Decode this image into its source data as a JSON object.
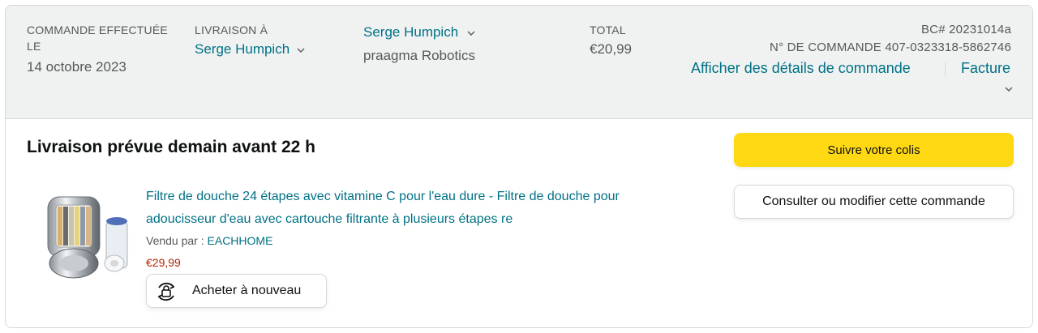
{
  "header": {
    "order_placed": {
      "label_line1": "COMMANDE EFFECTUÉE",
      "label_line2": "LE",
      "value": "14 octobre 2023"
    },
    "ship_to": {
      "label": "LIVRAISON À",
      "value": "Serge Humpich"
    },
    "account": {
      "name": "Serge Humpich",
      "company": "praagma Robotics"
    },
    "total": {
      "label": "TOTAL",
      "value": "€20,99"
    },
    "po_number": "BC# 20231014a",
    "order_number": "N° DE COMMANDE 407-0323318-5862746",
    "details_link": "Afficher des détails de commande",
    "invoice_link": "Facture"
  },
  "shipment": {
    "status": "Livraison prévue demain avant 22 h",
    "track_button": "Suivre votre colis",
    "edit_button": "Consulter ou modifier cette commande"
  },
  "item": {
    "title_line1": "Filtre de douche 24 étapes avec vitamine C pour l'eau dure - Filtre de douche pour",
    "title_line2": "adoucisseur d'eau avec cartouche filtrante à plusieurs étapes re",
    "sold_by_label": "Vendu par : ",
    "seller": "EACHHOME",
    "price": "€29,99",
    "buy_again": "Acheter à nouveau",
    "image_icon": "shower-filter-product-image"
  },
  "colors": {
    "accent_link": "#007185",
    "price": "#b12704",
    "primary_button": "#ffd814",
    "header_bg": "#f0f2f2"
  }
}
